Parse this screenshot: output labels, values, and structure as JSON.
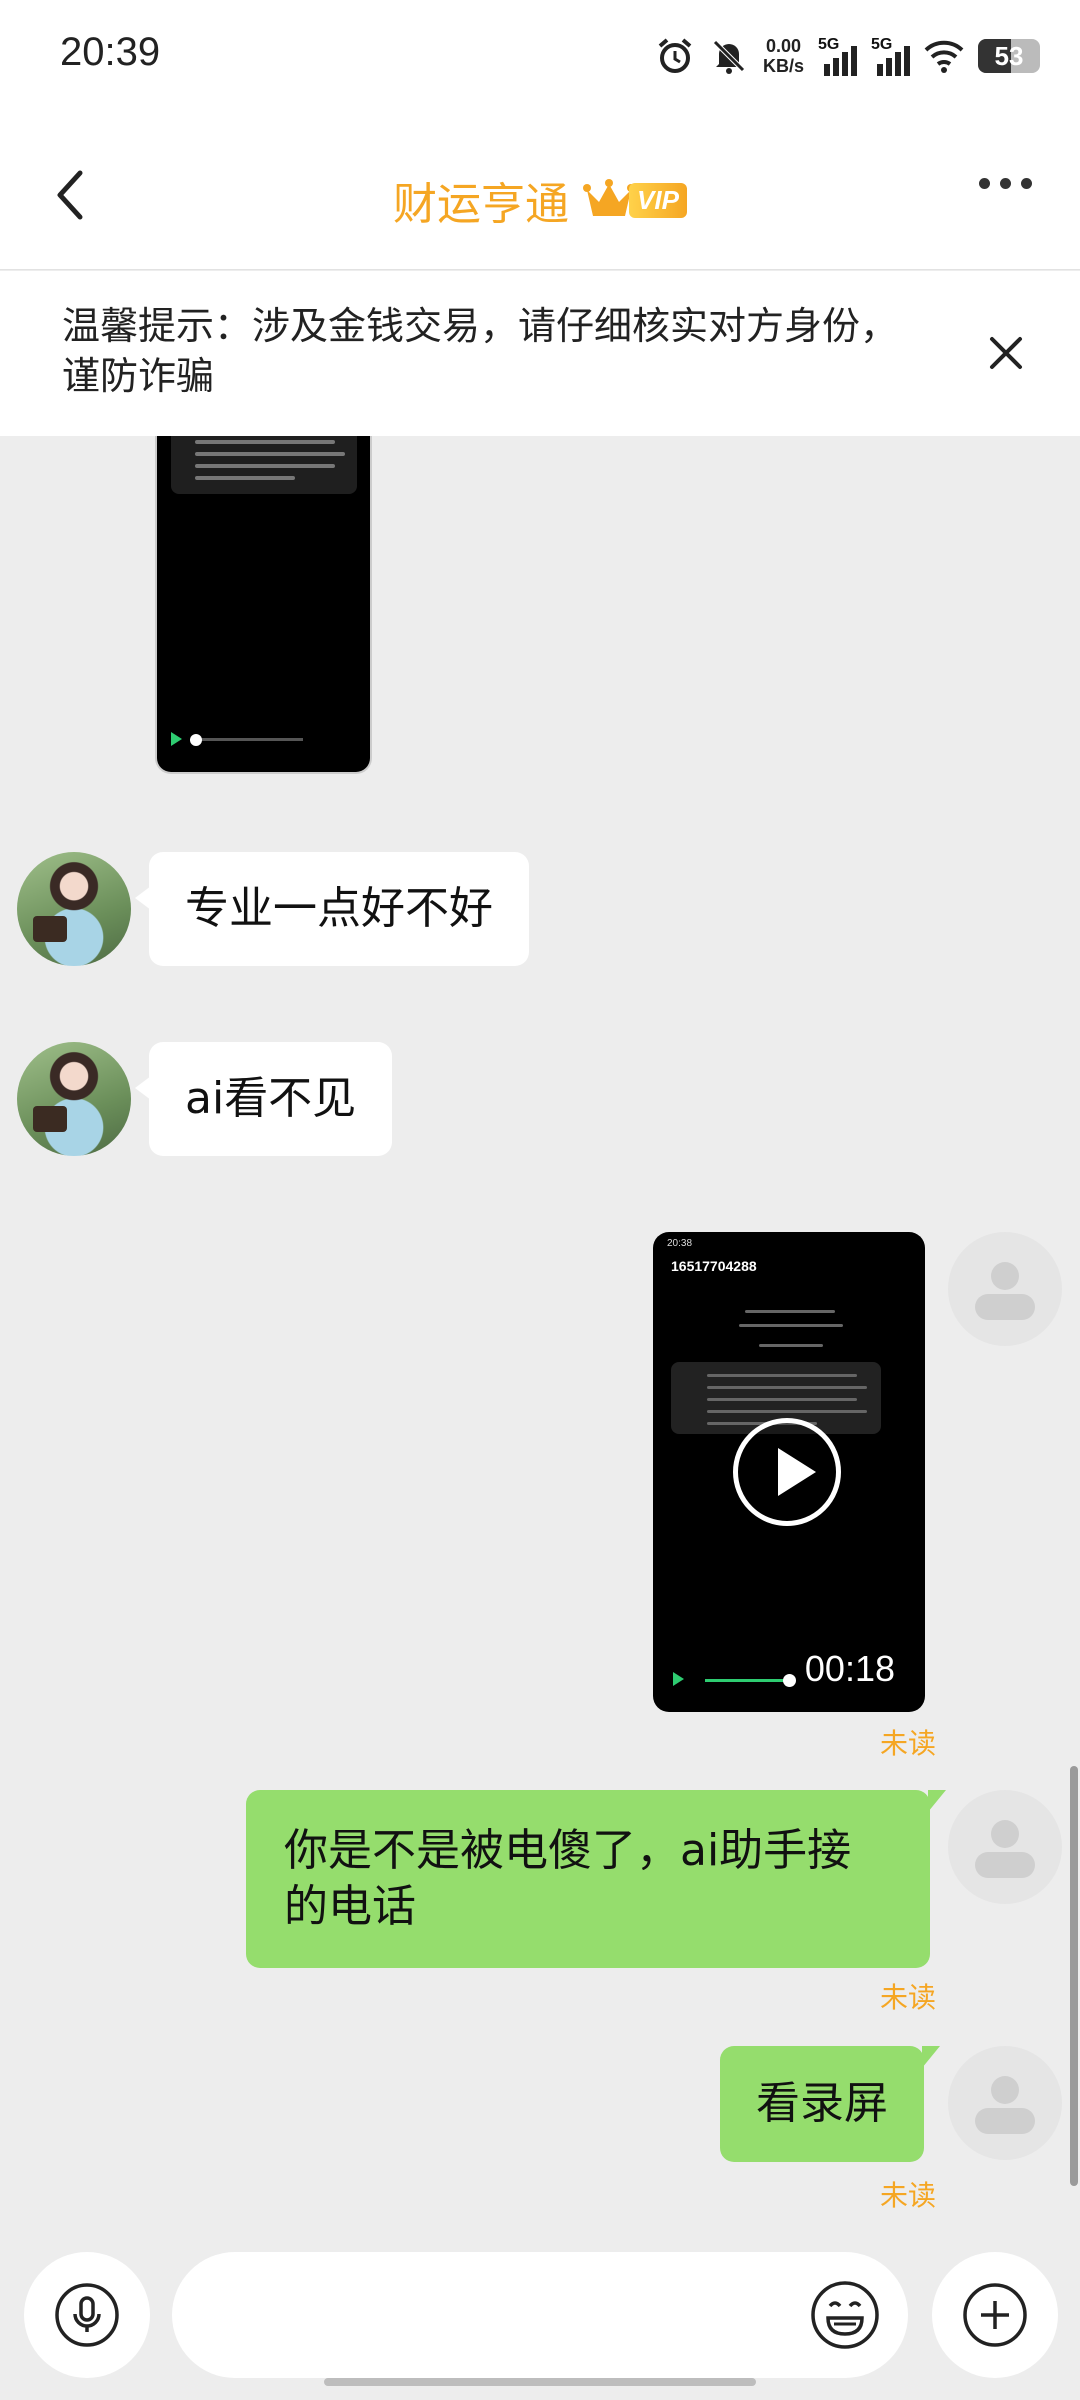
{
  "status_bar": {
    "time": "20:39",
    "net_speed_value": "0.00",
    "net_speed_unit": "KB/s",
    "signal1": "5G",
    "signal2": "5G",
    "battery": "53",
    "battery_level": 0.53,
    "icons": [
      "alarm-icon",
      "mute-bell-icon",
      "signal-icon",
      "signal-icon",
      "wifi-icon",
      "battery-icon"
    ]
  },
  "header": {
    "title": "财运亨通",
    "vip": "VIP",
    "back_icon": "chevron-left-icon",
    "more_icon": "more-dots-icon"
  },
  "notice": {
    "text": "温馨提示：涉及金钱交易，请仔细核实对方身份，谨防诈骗",
    "close_icon": "close-icon"
  },
  "messages": {
    "m1": "专业一点好不好",
    "m2": "ai看不见",
    "video_duration": "00:18",
    "video_phone": "16517704288",
    "video_status_time": "20:38",
    "m3": "你是不是被电傻了，ai助手接的电话",
    "m4": "看录屏",
    "unread": "未读"
  },
  "input": {
    "placeholder": "",
    "voice_icon": "microphone-icon",
    "emoji_icon": "emoji-icon",
    "plus_icon": "plus-icon"
  },
  "colors": {
    "accent": "#f5a623",
    "bubble_sent": "#95dd6d",
    "background": "#ededed"
  }
}
